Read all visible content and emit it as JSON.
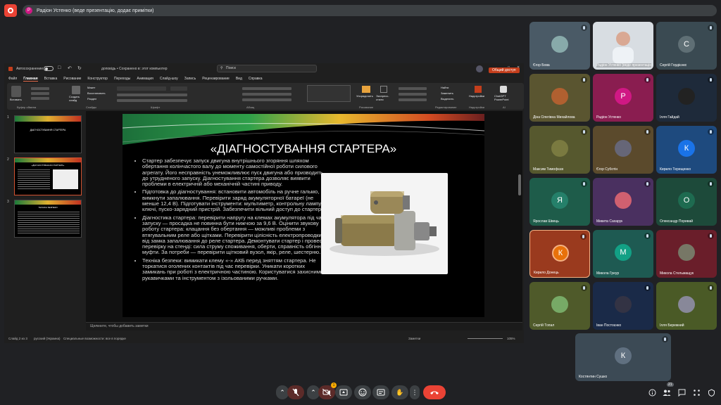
{
  "presenter_bar": {
    "initial": "Р",
    "text": "Радіон Устенко (веде презентацію, додає примітки)"
  },
  "ppt": {
    "autosave": "Автосохранение",
    "filename": "доповідь • Сохранено в: этот компьютер",
    "search_placeholder": "Поиск",
    "share_label": "Общий доступ",
    "menu": [
      "Файл",
      "Главная",
      "Вставка",
      "Рисование",
      "Конструктор",
      "Переходы",
      "Анимация",
      "Слайд-шоу",
      "Запись",
      "Рецензирование",
      "Вид",
      "Справка"
    ],
    "ribbon_groups": [
      "Буфер обмена",
      "Слайды",
      "Шрифт",
      "Абзац",
      "Рисование",
      "Редактирование",
      "Надстройки",
      "AI"
    ],
    "ribbon": {
      "paste": "Вставить",
      "new_slide": "Создать слайд",
      "layout": "Макет",
      "reset": "Восстановить",
      "section": "Раздел",
      "arrange": "Упорядочить",
      "express_styles": "Экспресс-стили",
      "find": "Найти",
      "replace": "Заменить",
      "select": "Выделить",
      "addins": "Надстройки",
      "chatgpt": "ChatGPT PowerPoint"
    },
    "notes_placeholder": "Щелкните, чтобы добавить заметки",
    "status": {
      "slide": "Слайд 2 из 3",
      "lang": "русский (Украина)",
      "accessibility": "Специальные возможности: все в порядке",
      "notes": "Заметки",
      "zoom": "105%"
    },
    "thumbnails": [
      {
        "num": "1",
        "title": "ДІАГНОСТУВАННЯ СТАРТЕРА"
      },
      {
        "num": "2",
        "title": "«ДІАГНОСТУВАННЯ СТАРТЕРА»"
      },
      {
        "num": "3",
        "title": "ТЕХНІКА БЕЗПЕКИ"
      }
    ],
    "slide": {
      "title": "«ДІАГНОСТУВАННЯ СТАРТЕРА»",
      "bullets": [
        "Стартер забезпечує запуск двигуна внутрішнього згоряння шляхом обертання колінчастого валу до моменту самостійної роботи силового агрегату. Його несправність унеможливлює пуск двигуна або призводить до утрудненого запуску. Діагностування стартера дозволяє виявити проблеми в електричній або механічній частині приводу.",
        "Підготовка до діагностування: встановити автомобіль на ручне гальмо, вимкнути запалювання. Перевірити заряд акумуляторної батареї (не менше 12,4 В). Підготувати інструменти: мультиметр, контрольну лампу, ключі, пуско-зарядний пристрій. Забезпечити вільний доступ до стартера.",
        "Діагностика стартера: перевірити напругу на клемах акумулятора під час запуску — просадка не повинна бути нижчою за 9,6 В. Оцінити звукову роботу стартера: клацання без обертання — можливі проблеми з втягувальним реле або щітками. Перевірити цілісність електропроводки від замка запалювання до реле стартера. Демонтувати стартер і провести перевірку на стенді: сила струму споживання, оберти, справність обгінної муфти. За потреби — перевірити щітковий вузол, якір, реле, шестерню.",
        "Техніка безпеки: вимикати клему «-» АКБ перед зняттям стартера. Не торкатися оголених контактів під час перевірки. Уникати коротких замикань при роботі з електричною частиною. Користуватися захисними рукавичками та інструментом з ізольованими ручками."
      ]
    }
  },
  "participants": [
    {
      "name": "Єгор Бова",
      "bg": "#4a5a66",
      "initial": "",
      "avatar_bg": "#8aa"
    },
    {
      "name": "Радіон Устенко (веде презентацію)",
      "bg": "#d8dde2",
      "initial": "",
      "avatar_bg": ""
    },
    {
      "name": "Сергій Гордієнко",
      "bg": "#3a4a52",
      "initial": "С",
      "avatar_bg": "#5f6f75"
    },
    {
      "name": "Діна Олегівна Михайлова",
      "bg": "#5a5530",
      "initial": "",
      "avatar_bg": "#b06030"
    },
    {
      "name": "Радіон Устенко",
      "bg": "#8a1d50",
      "initial": "Р",
      "avatar_bg": "#d01884"
    },
    {
      "name": "Ілля Гайдай",
      "bg": "#1e2a3a",
      "initial": "",
      "avatar_bg": "#222"
    },
    {
      "name": "Максим Тимофєєв",
      "bg": "#56582e",
      "initial": "",
      "avatar_bg": "#7a7a40"
    },
    {
      "name": "Єгор Суботін",
      "bg": "#5b4a2c",
      "initial": "",
      "avatar_bg": "#667"
    },
    {
      "name": "Кирило Терещенко",
      "bg": "#1e4a7e",
      "initial": "К",
      "avatar_bg": "#1a73e8"
    },
    {
      "name": "Ярослав Швець",
      "bg": "#1e5c4a",
      "initial": "Я",
      "avatar_bg": "#25806a"
    },
    {
      "name": "Микита Сахарук",
      "bg": "#4a3060",
      "initial": "",
      "avatar_bg": "#d06070"
    },
    {
      "name": "Олександр Поривай",
      "bg": "#1d4a3a",
      "initial": "О",
      "avatar_bg": "#1e6b50"
    },
    {
      "name": "Кирило Донець",
      "bg": "#9a3a1e",
      "initial": "К",
      "avatar_bg": "#e8710a"
    },
    {
      "name": "Микола Греур",
      "bg": "#1e5a52",
      "initial": "М",
      "avatar_bg": "#12a085"
    },
    {
      "name": "Микола Стельмащук",
      "bg": "#6a1e2a",
      "initial": "",
      "avatar_bg": "#776"
    },
    {
      "name": "Сергій Топал",
      "bg": "#4f5a2a",
      "initial": "",
      "avatar_bg": "#7a6"
    },
    {
      "name": "Іван Постоєнко",
      "bg": "#1a2a48",
      "initial": "",
      "avatar_bg": "#334"
    },
    {
      "name": "Ілля Бережний",
      "bg": "#4a5a26",
      "initial": "",
      "avatar_bg": "#889"
    },
    {
      "name": "Костянтин Сушко",
      "bg": "#3c4a55",
      "initial": "К",
      "avatar_bg": "#607080"
    }
  ],
  "bottom_bar": {
    "hand_badge": "1",
    "participants_count": "21"
  }
}
